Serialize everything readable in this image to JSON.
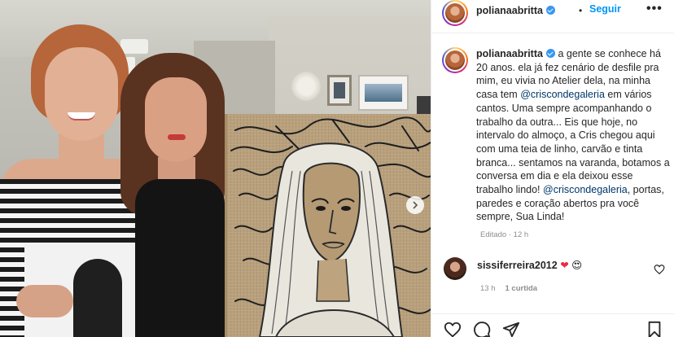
{
  "post": {
    "username": "polianaabritta",
    "follow_label": "Seguir",
    "separator": "•",
    "more_label": "•••",
    "caption_parts": {
      "before_mention1": "a gente se conhece há 20 anos. ela já fez cenário de desfile pra mim, eu vivia no Atelier dela, na minha casa tem ",
      "mention1": "@criscondegaleria",
      "middle": " em vários cantos. Uma sempre acompanhando o trabalho da outra... Eis que hoje, no intervalo do almoço, a Cris chegou aqui com uma teia de linho, carvão e tinta branca... sentamos na varanda, botamos a conversa em dia e ela deixou esse trabalho lindo! ",
      "mention2": "@criscondegaleria",
      "after_mention2": ", portas, paredes e coração abertos pra você sempre, Sua Linda!"
    },
    "edited_label": "Editado · 12 h"
  },
  "comment": {
    "username": "sissiferreira2012",
    "emoji_heart": "❤",
    "emoji_eyes": "😍",
    "time": "13 h",
    "likes": "1 curtida"
  },
  "icons": {
    "verified": "verified-badge-icon",
    "more": "more-options-icon",
    "next": "chevron-right-icon",
    "like": "heart-icon",
    "comment": "comment-icon",
    "share": "share-icon",
    "save": "bookmark-icon"
  },
  "colors": {
    "link_blue": "#0095f6",
    "mention_blue": "#00376b",
    "meta_gray": "#8e8e8e",
    "heart_red": "#ed2a45"
  }
}
